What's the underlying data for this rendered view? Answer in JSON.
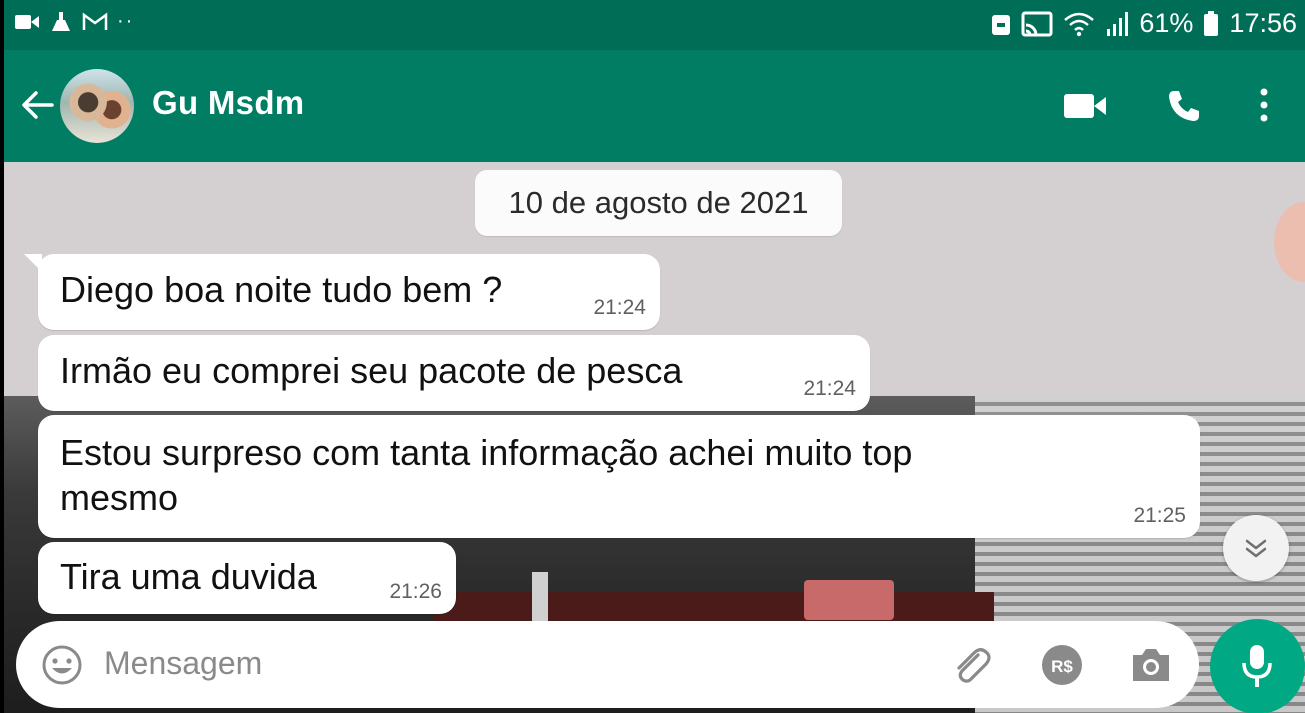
{
  "status_bar": {
    "battery": "61%",
    "time": "17:56",
    "left_icons": [
      "video-icon",
      "broom-icon",
      "gmail-icon",
      "more-dots"
    ],
    "right_icons": [
      "dnd-icon",
      "cast-icon",
      "wifi-icon",
      "signal-icon",
      "battery-icon"
    ]
  },
  "header": {
    "contact_name": "Gu Msdm",
    "icons": [
      "back-arrow-icon",
      "video-call-icon",
      "phone-icon",
      "overflow-menu-icon"
    ]
  },
  "chat": {
    "date_label": "10 de agosto de 2021",
    "messages": [
      {
        "text": "Diego boa noite tudo bem ?",
        "time": "21:24"
      },
      {
        "text": "Irmão eu comprei seu pacote de pesca",
        "time": "21:24"
      },
      {
        "text_line1": "Estou surpreso com tanta informação achei muito top",
        "text_line2": "mesmo",
        "time": "21:25"
      },
      {
        "text": "Tira uma duvida",
        "time": "21:26"
      }
    ]
  },
  "composer": {
    "placeholder": "Mensagem",
    "icons": [
      "emoji-icon",
      "attach-icon",
      "payment-icon",
      "camera-icon",
      "mic-icon"
    ]
  },
  "colors": {
    "header_green": "#007d63",
    "status_green": "#006e57",
    "mic_green": "#00a884",
    "bubble_white": "#ffffff"
  }
}
